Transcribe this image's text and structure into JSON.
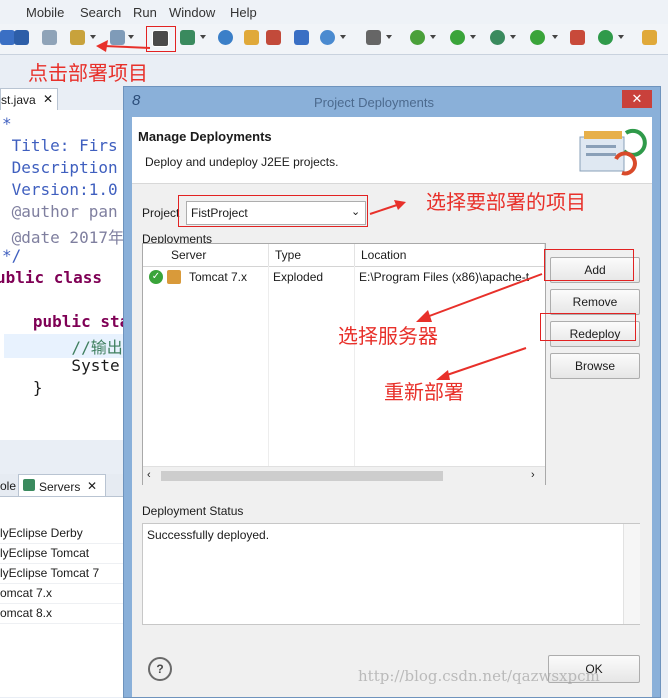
{
  "menubar": {
    "items": [
      "Mobile",
      "Search",
      "Run",
      "Window",
      "Help"
    ]
  },
  "editor": {
    "tab_label": "st.java",
    "lines": [
      "*",
      " Title: Firs",
      " Description",
      " Version:1.0",
      " @author pan",
      " @date 2017年",
      "*/",
      "ublic class ",
      "",
      "   public sta",
      "       //输出",
      "       Syste",
      "   }"
    ]
  },
  "servers": {
    "tab_left": "ole",
    "tab_label": "Servers",
    "items": [
      "lyEclipse Derby",
      "lyEclipse Tomcat",
      "lyEclipse Tomcat 7",
      "omcat  7.x",
      "omcat  8.x"
    ]
  },
  "dialog": {
    "title": "Project Deployments",
    "heading": "Manage Deployments",
    "subheading": "Deploy and undeploy J2EE projects.",
    "project_label": "Project",
    "project_value": "FistProject",
    "deployments_label": "Deployments",
    "columns": [
      "Server",
      "Type",
      "Location"
    ],
    "rows": [
      {
        "server": "Tomcat  7.x",
        "type": "Exploded",
        "location": "E:\\Program Files (x86)\\apache-t"
      }
    ],
    "buttons": {
      "add": "Add",
      "remove": "Remove",
      "redeploy": "Redeploy",
      "browse": "Browse",
      "ok": "OK"
    },
    "status_label": "Deployment Status",
    "status_text": "Successfully deployed.",
    "help_glyph": "?"
  },
  "annotations": {
    "deploy_project": "点击部署项目",
    "select_project": "选择要部署的项目",
    "select_server": "选择服务器",
    "redeploy": "重新部署"
  },
  "watermark": "http://blog.csdn.net/qazwsxpcm",
  "colors": {
    "annotation": "#e8302a",
    "dialog_frame": "#8ab0d9",
    "close_button": "#c9413b",
    "success": "#3aa43a"
  }
}
